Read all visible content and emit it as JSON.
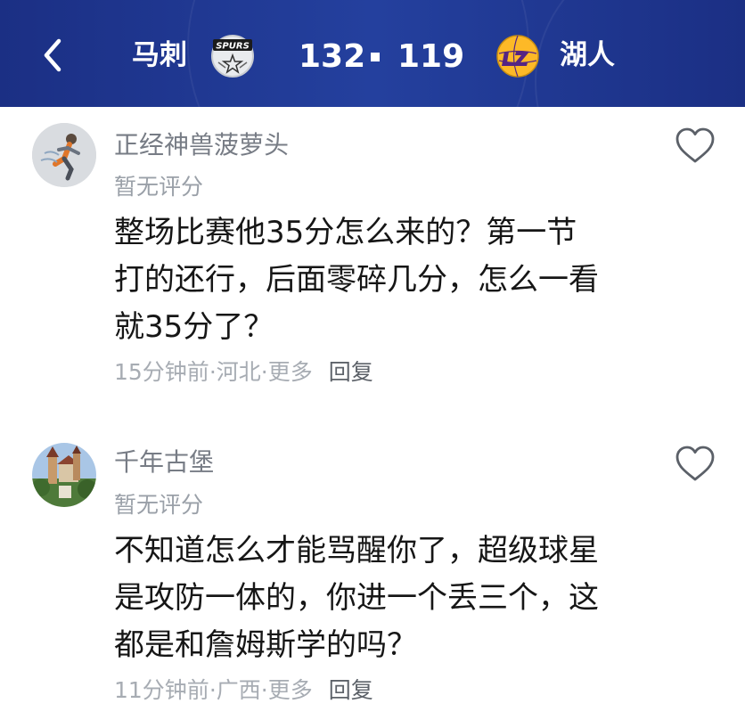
{
  "header": {
    "back_icon": "chevron-left-icon",
    "home_team": "马刺",
    "home_logo_text": "SPURS",
    "home_score": "132",
    "away_score": "119",
    "away_team": "湖人",
    "colors": {
      "background": "#1b2f84",
      "text": "#ffffff",
      "lakers_purple": "#552583",
      "lakers_gold": "#fdb927"
    }
  },
  "comments": [
    {
      "username": "正经神兽菠萝头",
      "rating": "暂无评分",
      "lines": [
        "整场比赛他35分怎么来的？第一节",
        "打的还行，后面零碎几分，怎么一看",
        "就35分了？"
      ],
      "time": "15分钟前",
      "location": "河北",
      "more": "更多",
      "reply": "回复",
      "like_icon": "heart-outline-icon"
    },
    {
      "username": "千年古堡",
      "rating": "暂无评分",
      "lines": [
        "不知道怎么才能骂醒你了，超级球星",
        "是攻防一体的，你进一个丢三个，这",
        "都是和詹姆斯学的吗？"
      ],
      "time": "11分钟前",
      "location": "广西",
      "more": "更多",
      "reply": "回复",
      "like_icon": "heart-outline-icon"
    }
  ],
  "separator": " · "
}
